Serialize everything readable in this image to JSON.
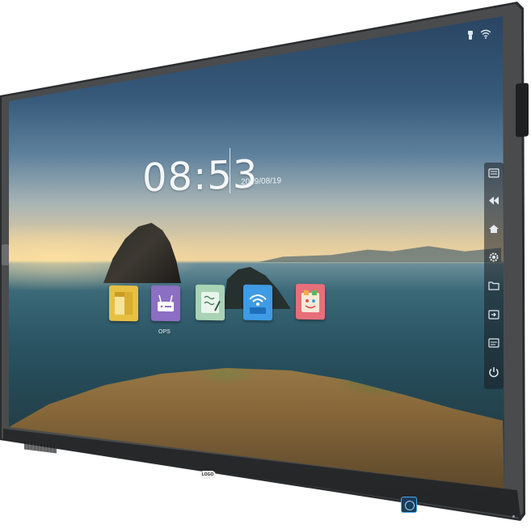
{
  "home_screen": {
    "clock": {
      "time": "08:53",
      "date": "2019/08/19"
    },
    "apps": [
      {
        "name": "files",
        "label": ""
      },
      {
        "name": "ops",
        "label": "OPS"
      },
      {
        "name": "note",
        "label": ""
      },
      {
        "name": "cast",
        "label": ""
      },
      {
        "name": "paint",
        "label": ""
      }
    ],
    "status_icons": [
      "usb-icon",
      "wifi-icon"
    ],
    "sidebar_tools": [
      "menu-icon",
      "back-icon",
      "home-icon",
      "settings-icon",
      "folder-icon",
      "source-icon",
      "whiteboard-icon",
      "power-icon"
    ]
  },
  "bezel": {
    "logo_text": "LOGO"
  },
  "colors": {
    "bezel": "#2b2c2e",
    "files_app": "#e7c043",
    "ops_app": "#8b6fc2",
    "note_app": "#a9d3b4",
    "cast_app": "#3f9be4",
    "paint_app": "#e76f7a",
    "camera_ring": "#4aa8e8"
  }
}
